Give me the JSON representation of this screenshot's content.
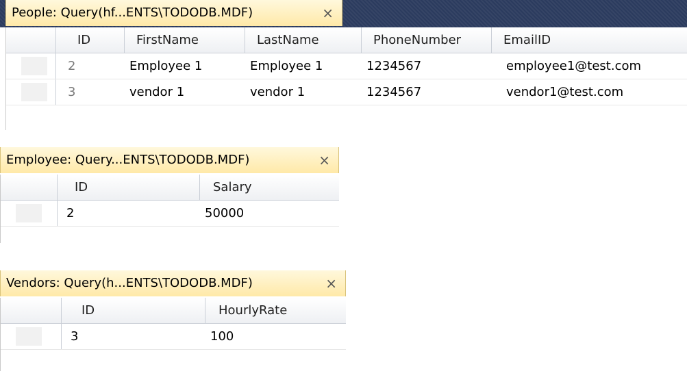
{
  "panels": {
    "people": {
      "tab_title": "People: Query(hf...ENTS\\TODODB.MDF)",
      "close": "×",
      "columns": [
        "ID",
        "FirstName",
        "LastName",
        "PhoneNumber",
        "EmailID"
      ],
      "rows": [
        [
          "2",
          "Employee 1",
          "Employee 1",
          "1234567",
          "employee1@test.com"
        ],
        [
          "3",
          "vendor 1",
          "vendor 1",
          "1234567",
          "vendor1@test.com"
        ]
      ]
    },
    "employee": {
      "tab_title": "Employee: Query...ENTS\\TODODB.MDF)",
      "close": "×",
      "columns": [
        "ID",
        "Salary"
      ],
      "rows": [
        [
          "2",
          "50000"
        ]
      ]
    },
    "vendors": {
      "tab_title": "Vendors: Query(h...ENTS\\TODODB.MDF)",
      "close": "×",
      "columns": [
        "ID",
        "HourlyRate"
      ],
      "rows": [
        [
          "3",
          "100"
        ]
      ]
    }
  }
}
